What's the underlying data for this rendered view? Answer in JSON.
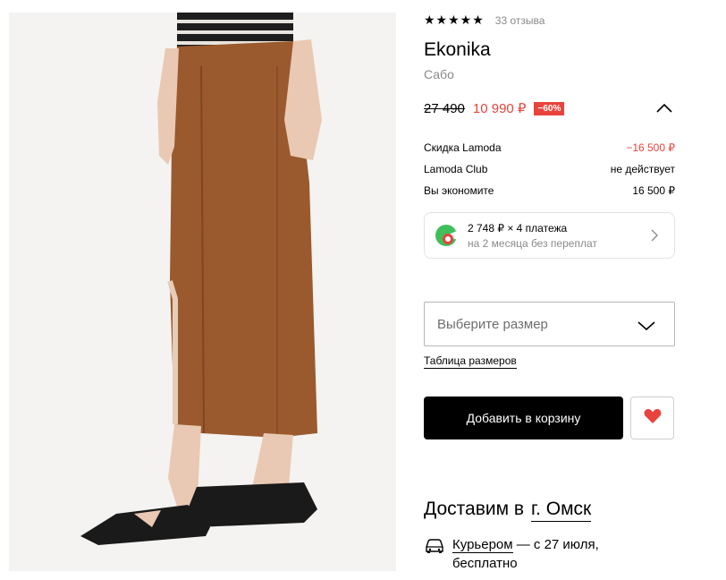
{
  "product": {
    "rating_stars": "★★★★★",
    "reviews": "33 отзыва",
    "brand": "Ekonika",
    "type": "Сабо"
  },
  "price": {
    "old": "27 490",
    "current": "10 990 ₽",
    "discount_badge": "−60%"
  },
  "details": [
    {
      "label": "Скидка Lamoda",
      "value": "−16 500 ₽"
    },
    {
      "label": "Lamoda Club",
      "value": "не действует"
    },
    {
      "label": "Вы экономите",
      "value": "16 500 ₽"
    }
  ],
  "installment": {
    "main": "2 748 ₽ × 4 платежа",
    "sub": "на 2 месяца без переплат"
  },
  "size": {
    "placeholder": "Выберите размер",
    "table_link": "Таблица размеров"
  },
  "actions": {
    "add_to_cart": "Добавить в корзину"
  },
  "delivery": {
    "title": "Доставим в",
    "city": "г. Омск",
    "courier_link": "Курьером",
    "courier_date": " — с 27 июля,",
    "courier_cost": "бесплатно"
  },
  "colors": {
    "accent_red": "#e8433c",
    "button_black": "#000000",
    "muted_gray": "#8a8a8a",
    "skirt_brown": "#9a5a2e"
  },
  "icons": [
    "star-icon",
    "chevron-up-icon",
    "installment-logo-icon",
    "chevron-right-icon",
    "chevron-down-icon",
    "heart-icon",
    "car-icon"
  ]
}
